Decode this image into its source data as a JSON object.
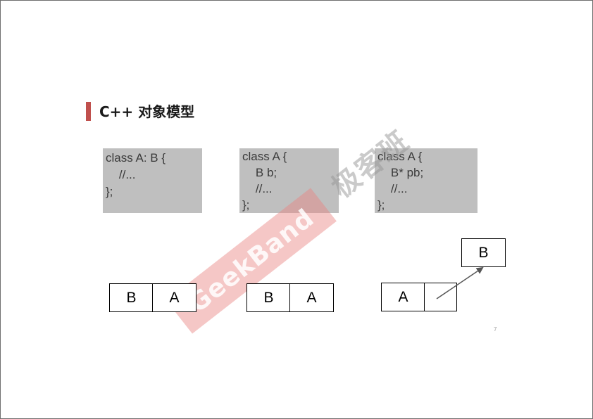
{
  "title": "C++ 对象模型",
  "code_blocks": [
    {
      "lines": [
        "class A: B {",
        "    //...",
        "};"
      ]
    },
    {
      "lines": [
        "class A {",
        "    B b;",
        "    //...",
        "};"
      ]
    },
    {
      "lines": [
        "class A {",
        "    B* pb;",
        "    //...",
        "};"
      ]
    }
  ],
  "layouts": {
    "inheritance": {
      "left": "B",
      "right": "A"
    },
    "composition": {
      "left": "B",
      "right": "A"
    },
    "delegation": {
      "left": "A",
      "right": "",
      "pointee": "B"
    }
  },
  "page_number": "7",
  "watermark": {
    "brand": "GeekBand",
    "chinese": "极客班"
  },
  "colors": {
    "accent": "#c0504d",
    "code_bg": "#bfbfbf"
  }
}
